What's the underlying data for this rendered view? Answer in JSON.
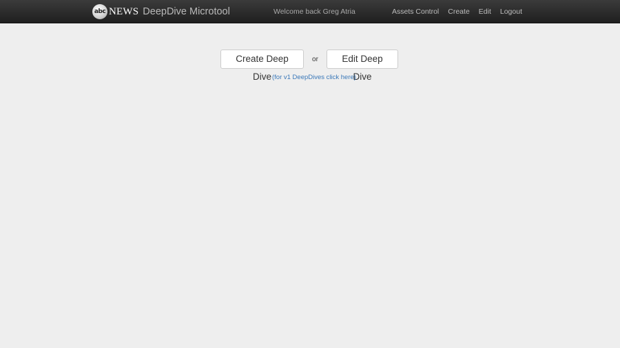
{
  "header": {
    "brand": {
      "logo_text": "abc",
      "news_text": "NEWS",
      "app_title": "DeepDive Microtool"
    },
    "welcome": "Welcome back Greg Atria",
    "nav": [
      {
        "label": "Assets Control"
      },
      {
        "label": "Create"
      },
      {
        "label": "Edit"
      },
      {
        "label": "Logout"
      }
    ]
  },
  "main": {
    "create_button": "Create Deep Dive",
    "or_text": "or",
    "edit_button": "Edit Deep Dive",
    "v1_link": "(for v1 DeepDives click here)"
  },
  "colors": {
    "background": "#eeeeee",
    "navbar": "#2a2a2a",
    "link": "#3a78b9"
  }
}
